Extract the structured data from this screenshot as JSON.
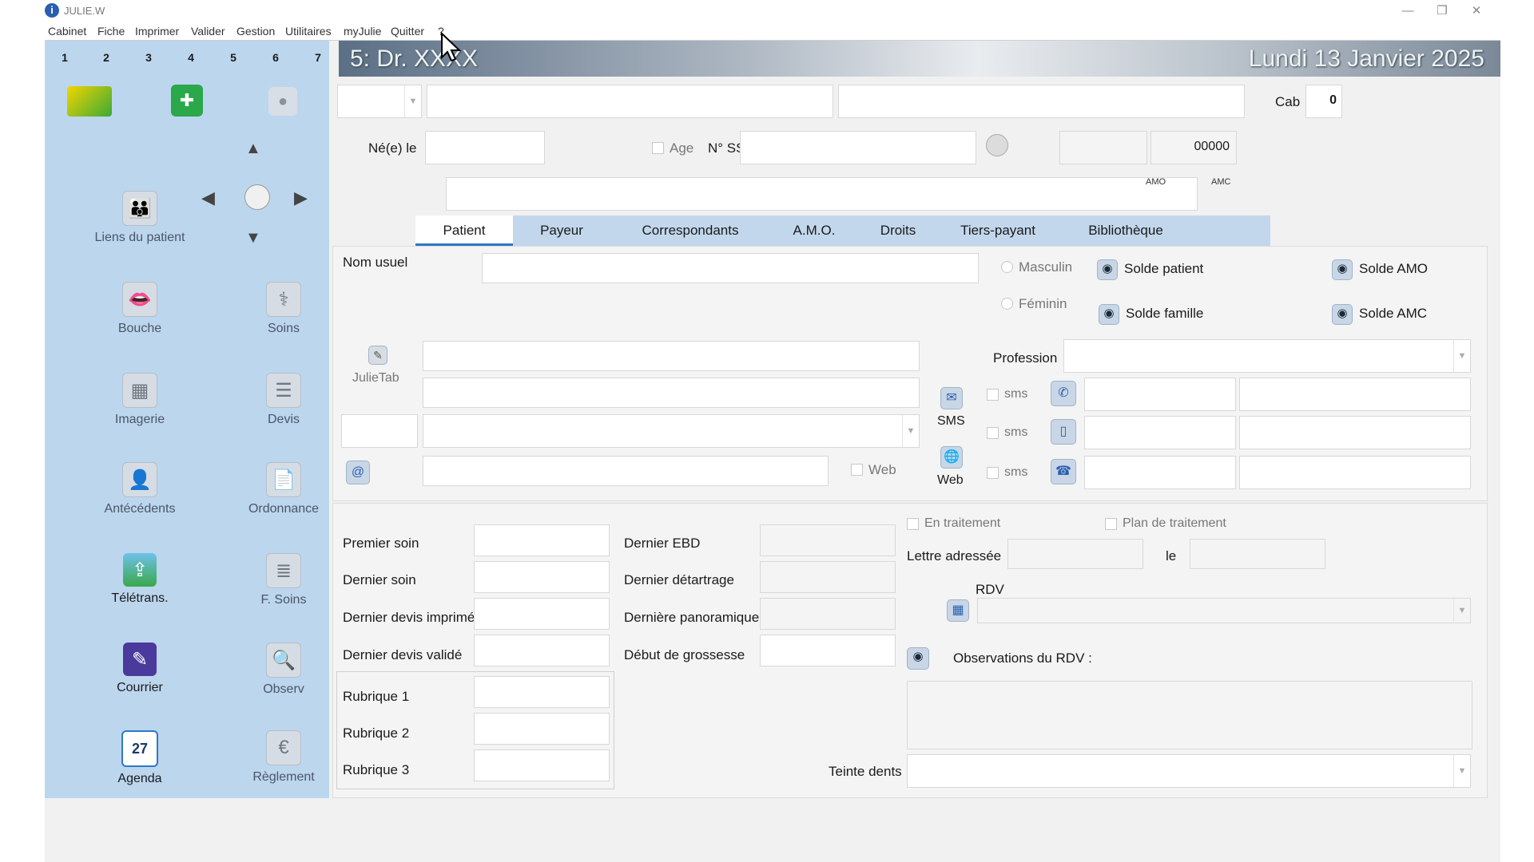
{
  "window": {
    "title": "JULIE.W",
    "controls": [
      "—",
      "❐",
      "✕"
    ]
  },
  "menu": [
    "Cabinet",
    "Fiche",
    "Imprimer",
    "Valider",
    "Gestion",
    "Utilitaires",
    "myJulie",
    "Quitter",
    "?"
  ],
  "sidebar": {
    "numbers": [
      "1",
      "2",
      "3",
      "4",
      "5",
      "6",
      "7"
    ],
    "liens_label": "Liens du patient",
    "buttons": [
      {
        "label": "Bouche"
      },
      {
        "label": "Soins"
      },
      {
        "label": "Imagerie"
      },
      {
        "label": "Devis"
      },
      {
        "label": "Antécédents"
      },
      {
        "label": "Ordonnance"
      },
      {
        "label": "Télétrans."
      },
      {
        "label": "F. Soins"
      },
      {
        "label": "Courrier"
      },
      {
        "label": "Observ"
      },
      {
        "label": "Agenda"
      },
      {
        "label": "Règlement"
      }
    ],
    "agenda_day": "27"
  },
  "header": {
    "practitioner": "5: Dr. XXXX",
    "date": "Lundi 13 Janvier 2025"
  },
  "patient_header": {
    "cab_label": "Cab",
    "cab_value": "0",
    "born_label": "Né(e) le",
    "age_label": "Age",
    "ss_label": "N° SS",
    "counter_value": "00000",
    "amo_label": "AMO",
    "amc_label": "AMC"
  },
  "tabs": [
    "Patient",
    "Payeur",
    "Correspondants",
    "A.M.O.",
    "Droits",
    "Tiers-payant",
    "Bibliothèque"
  ],
  "patient_tab": {
    "nom_usuel": "Nom usuel",
    "masculin": "Masculin",
    "feminin": "Féminin",
    "solde_patient": "Solde patient",
    "solde_famille": "Solde famille",
    "solde_amo": "Solde AMO",
    "solde_amc": "Solde AMC",
    "julietab": "JulieTab",
    "profession": "Profession",
    "sms": "sms",
    "sms_button": "SMS",
    "web_button": "Web",
    "web_check": "Web",
    "at": "@"
  },
  "care": {
    "premier_soin": "Premier soin",
    "dernier_soin": "Dernier soin",
    "dernier_devis_imprime": "Dernier devis imprimé",
    "dernier_devis_valide": "Dernier devis validé",
    "dernier_ebd": "Dernier EBD",
    "dernier_detartrage": "Dernier détartrage",
    "derniere_panoramique": "Dernière panoramique",
    "debut_grossesse": "Début de grossesse",
    "rubrique1": "Rubrique 1",
    "rubrique2": "Rubrique 2",
    "rubrique3": "Rubrique 3",
    "en_traitement": "En traitement",
    "plan_traitement": "Plan de traitement",
    "lettre_adressee": "Lettre adressée",
    "le": "le",
    "rdv": "RDV",
    "observations_rdv": "Observations du RDV :",
    "teinte_dents": "Teinte dents"
  },
  "colors": {
    "sidebar": "#bcd6ee",
    "tab_bar": "#c2d7ec",
    "accent": "#2f78c4"
  }
}
